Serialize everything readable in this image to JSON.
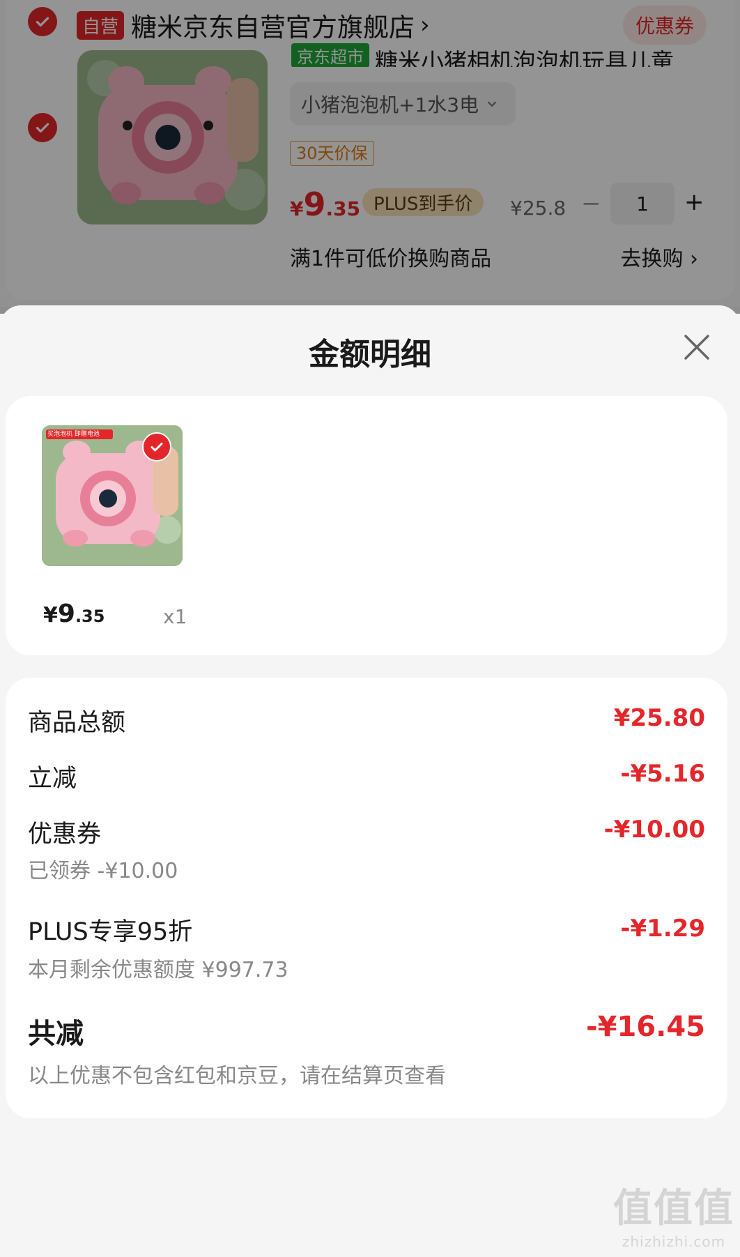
{
  "cart": {
    "self_tag": "自营",
    "store_name": "糖米京东自营官方旗舰店",
    "store_arrow": "›",
    "coupon_label": "优惠券",
    "market_tag": "京东超市",
    "product_title": "糖米小猪相机泡泡机玩具儿童",
    "spec": "小猪泡泡机+1水3电",
    "guarantee": "30天价保",
    "price_symbol": "¥",
    "price_int": "9",
    "price_dec": ".35",
    "plus_label": "PLUS到手价",
    "original_price": "¥25.8",
    "qty_minus": "−",
    "quantity": "1",
    "qty_plus": "+",
    "exchange_text": "满1件可低价换购商品",
    "exchange_link": "去换购 ›"
  },
  "sheet": {
    "title": "金额明细",
    "item": {
      "price_symbol": "¥",
      "price_int": "9",
      "price_dec": ".35",
      "qty": "x1",
      "thumb_banner": "买泡泡机 即赠电池"
    },
    "rows": [
      {
        "label": "商品总额",
        "value": "¥25.80",
        "sub": ""
      },
      {
        "label": "立减",
        "value": "-¥5.16",
        "sub": ""
      },
      {
        "label": "优惠券",
        "value": "-¥10.00",
        "sub": "已领券 -¥10.00"
      },
      {
        "label": "PLUS专享95折",
        "value": "-¥1.29",
        "sub": "本月剩余优惠额度 ¥997.73"
      }
    ],
    "total": {
      "label": "共减",
      "value": "-¥16.45",
      "note": "以上优惠不包含红包和京豆，请在结算页查看"
    }
  },
  "watermark": {
    "big": "值值值",
    "small": "zhizhizhi.com"
  },
  "colors": {
    "accent_red": "#e4262a",
    "plus_gold": "#f7e4b8",
    "sheet_bg": "#f5f5f5"
  }
}
